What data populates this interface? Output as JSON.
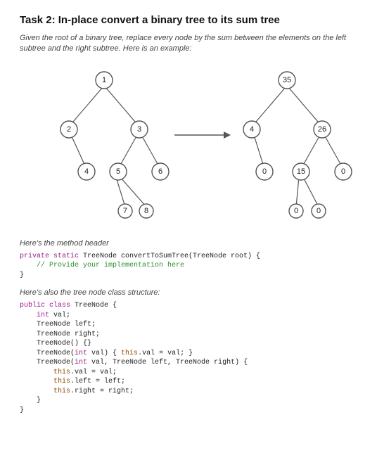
{
  "title": "Task 2: In-place convert a binary tree to its sum tree",
  "description": "Given the root of a binary tree, replace every node by the sum between the elements on the left subtree and the right subtree. Here is an example:",
  "section_header1": "Here's the method header",
  "section_header2": "Here's also the tree node class structure:",
  "code1": {
    "l1a": "private static",
    "l1b": " TreeNode convertToSumTree(TreeNode root) {",
    "l2": "    // Provide your implementation here",
    "l3": "}"
  },
  "code2": {
    "l1a": "public class",
    "l1b": " TreeNode {",
    "l2a": "    ",
    "l2b": "int",
    "l2c": " val;",
    "l3": "    TreeNode left;",
    "l4": "    TreeNode right;",
    "l5": "    TreeNode() {}",
    "l6a": "    TreeNode(",
    "l6b": "int",
    "l6c": " val) { ",
    "l6d": "this",
    "l6e": ".val = val; }",
    "l7a": "    TreeNode(",
    "l7b": "int",
    "l7c": " val, TreeNode left, TreeNode right) {",
    "l8a": "        ",
    "l8b": "this",
    "l8c": ".val = val;",
    "l9a": "        ",
    "l9b": "this",
    "l9c": ".left = left;",
    "l10a": "        ",
    "l10b": "this",
    "l10c": ".right = right;",
    "l11": "    }",
    "l12": "}"
  },
  "chart_data": {
    "type": "diagram",
    "description": "Binary tree before and after in-place sum-tree conversion",
    "left_tree": {
      "value": 1,
      "left": {
        "value": 2,
        "left": null,
        "right": {
          "value": 4,
          "left": null,
          "right": null
        }
      },
      "right": {
        "value": 3,
        "left": {
          "value": 5,
          "left": {
            "value": 7,
            "left": null,
            "right": null
          },
          "right": {
            "value": 8,
            "left": null,
            "right": null
          }
        },
        "right": {
          "value": 6,
          "left": null,
          "right": null
        }
      }
    },
    "right_tree": {
      "value": 35,
      "left": {
        "value": 4,
        "left": null,
        "right": {
          "value": 0,
          "left": null,
          "right": null
        }
      },
      "right": {
        "value": 26,
        "left": {
          "value": 15,
          "left": {
            "value": 0,
            "left": null,
            "right": null
          },
          "right": {
            "value": 0,
            "left": null,
            "right": null
          }
        },
        "right": {
          "value": 0,
          "left": null,
          "right": null
        }
      }
    },
    "left_tree_labels": {
      "root": "1",
      "l": "2",
      "lr": "4",
      "r": "3",
      "rl": "5",
      "rll": "7",
      "rlr": "8",
      "rr": "6"
    },
    "right_tree_labels": {
      "root": "35",
      "l": "4",
      "lr": "0",
      "r": "26",
      "rl": "15",
      "rll": "0",
      "rlr": "0",
      "rr": "0"
    }
  }
}
